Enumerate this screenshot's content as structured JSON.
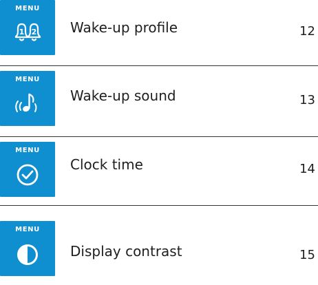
{
  "colors": {
    "tile": "#0f8fd0",
    "rule": "#333333",
    "text": "#1e1e1e"
  },
  "entries": [
    {
      "menu_label": "MENU",
      "icon": "bell-1-2-icon",
      "title": "Wake-up profile",
      "page": "12"
    },
    {
      "menu_label": "MENU",
      "icon": "music-note-sound-icon",
      "title": "Wake-up sound",
      "page": "13"
    },
    {
      "menu_label": "MENU",
      "icon": "clock-check-icon",
      "title": "Clock time",
      "page": "14"
    },
    {
      "menu_label": "MENU",
      "icon": "contrast-icon",
      "title": "Display contrast",
      "page": "15"
    }
  ]
}
